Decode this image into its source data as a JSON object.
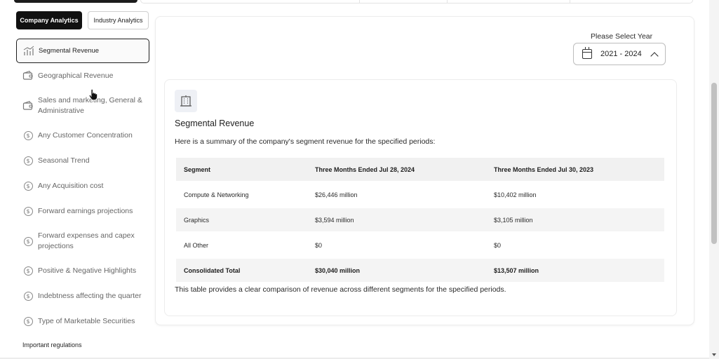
{
  "tabs": {
    "company": "Company Analytics",
    "industry": "Industry Analytics"
  },
  "sidebar": {
    "items": [
      {
        "label": "Segmental Revenue",
        "icon": "segment-chart-icon"
      },
      {
        "label": "Geographical Revenue",
        "icon": "wallet-icon"
      },
      {
        "label": "Sales and marketing, General & Administrative",
        "icon": "wallet-icon"
      },
      {
        "label": "Any Customer Concentration",
        "icon": "dollar-icon"
      },
      {
        "label": "Seasonal Trend",
        "icon": "dollar-icon"
      },
      {
        "label": "Any Acquisition cost",
        "icon": "dollar-icon"
      },
      {
        "label": "Forward earnings projections",
        "icon": "dollar-icon"
      },
      {
        "label": "Forward expenses and capex projections",
        "icon": "dollar-icon"
      },
      {
        "label": "Positive & Negative Highlights",
        "icon": "dollar-icon"
      },
      {
        "label": "Indebtness affecting the quarter",
        "icon": "dollar-icon"
      },
      {
        "label": "Type of Marketable Securities",
        "icon": "dollar-icon"
      }
    ],
    "footer_label": "Important regulations"
  },
  "year": {
    "label": "Please Select Year",
    "value": "2021 - 2024"
  },
  "section": {
    "icon": "building-icon",
    "title": "Segmental Revenue",
    "summary": "Here is a summary of the company's segment revenue for the specified periods:",
    "footnote": "This table provides a clear comparison of revenue across different segments for the specified periods."
  },
  "table": {
    "headers": [
      "Segment",
      "Three Months Ended Jul 28, 2024",
      "Three Months Ended Jul 30, 2023"
    ],
    "rows": [
      [
        "Compute & Networking",
        "$26,446 million",
        "$10,402 million"
      ],
      [
        "Graphics",
        "$3,594 million",
        "$3,105 million"
      ],
      [
        "All Other",
        "$0",
        "$0"
      ],
      [
        "Consolidated Total",
        "$30,040 million",
        "$13,507 million"
      ]
    ]
  },
  "colors": {
    "accent": "#111111",
    "border": "#ececec",
    "row_shade": "#f4f4f4"
  }
}
